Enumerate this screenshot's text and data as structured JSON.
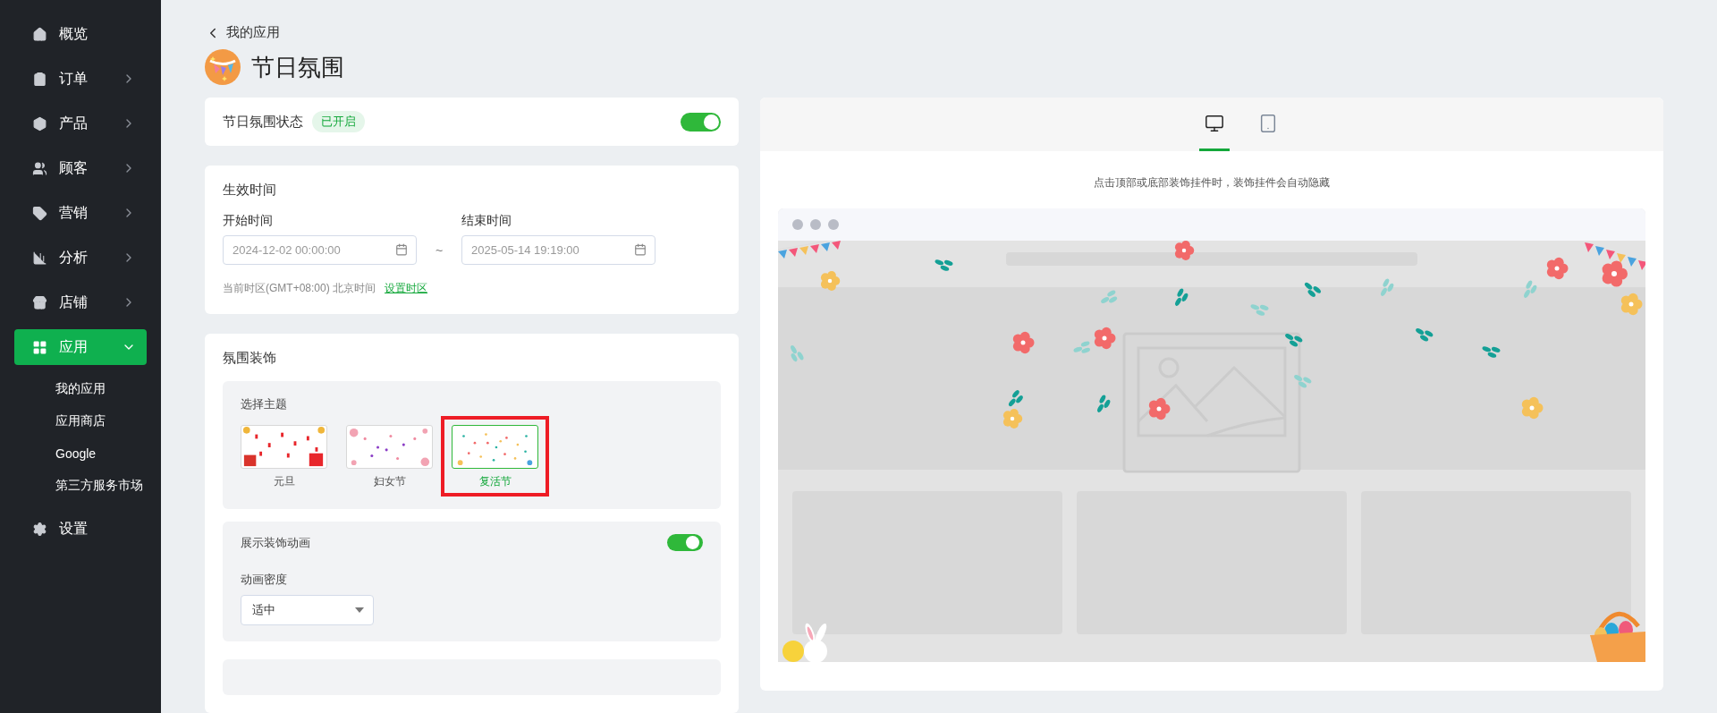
{
  "sidebar": {
    "items": [
      {
        "label": "概览",
        "selected": false,
        "expandable": false
      },
      {
        "label": "订单",
        "selected": false,
        "expandable": true,
        "expanded": false
      },
      {
        "label": "产品",
        "selected": false,
        "expandable": true,
        "expanded": false
      },
      {
        "label": "顾客",
        "selected": false,
        "expandable": true,
        "expanded": false
      },
      {
        "label": "营销",
        "selected": false,
        "expandable": true,
        "expanded": false
      },
      {
        "label": "分析",
        "selected": false,
        "expandable": true,
        "expanded": false
      },
      {
        "label": "店铺",
        "selected": false,
        "expandable": true,
        "expanded": false
      },
      {
        "label": "应用",
        "selected": true,
        "expandable": true,
        "expanded": true,
        "children": [
          {
            "label": "我的应用"
          },
          {
            "label": "应用商店"
          },
          {
            "label": "Google"
          },
          {
            "label": "第三方服务市场"
          }
        ]
      },
      {
        "label": "设置",
        "selected": false,
        "expandable": false
      }
    ]
  },
  "breadcrumb": {
    "back_label": "我的应用"
  },
  "page_title": "节日氛围",
  "status_card": {
    "label": "节日氛围状态",
    "badge": "已开启",
    "on": true
  },
  "time_card": {
    "title": "生效时间",
    "start": {
      "label": "开始时间",
      "value": "2024-12-02 00:00:00"
    },
    "separator": "~",
    "end": {
      "label": "结束时间",
      "value": "2025-05-14 19:19:00"
    },
    "timezone_note": "当前时区(GMT+08:00) 北京时间",
    "timezone_link": "设置时区"
  },
  "decoration_card": {
    "title": "氛围装饰",
    "theme_section": {
      "label": "选择主题",
      "themes": [
        {
          "name": "元旦",
          "selected": false
        },
        {
          "name": "妇女节",
          "selected": false
        },
        {
          "name": "复活节",
          "selected": true
        }
      ]
    },
    "animation": {
      "label": "展示装饰动画",
      "on": true,
      "density_label": "动画密度",
      "density_value": "适中"
    }
  },
  "preview": {
    "devices": [
      {
        "kind": "desktop",
        "selected": true
      },
      {
        "kind": "tablet",
        "selected": false
      }
    ],
    "tip": "点击顶部或底部装饰挂件时，装饰挂件会自动隐藏"
  }
}
